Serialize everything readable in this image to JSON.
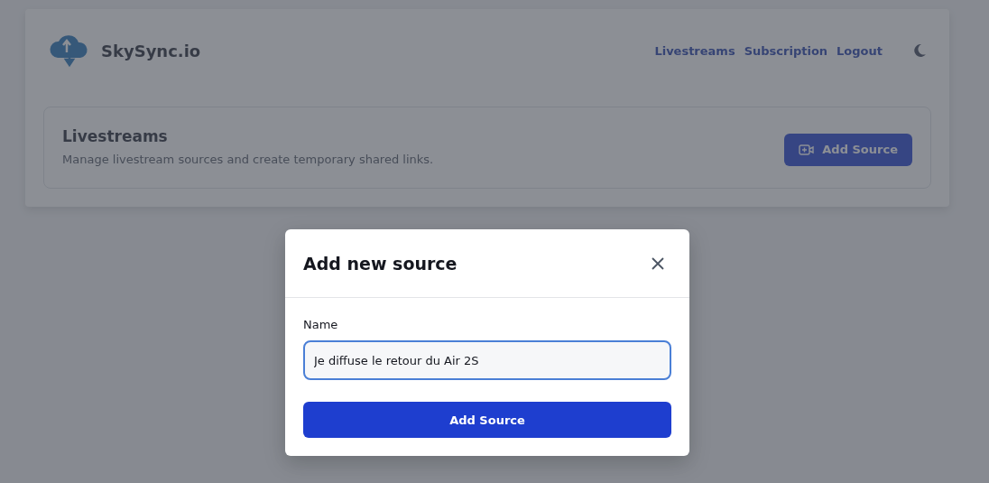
{
  "brand": {
    "name": "SkySync.io"
  },
  "nav": {
    "links": [
      {
        "label": "Livestreams"
      },
      {
        "label": "Subscription"
      },
      {
        "label": "Logout"
      }
    ],
    "dark_mode": false
  },
  "section": {
    "title": "Livestreams",
    "description": "Manage livestream sources and create temporary shared links.",
    "button": "Add Source"
  },
  "dialog": {
    "title": "Add new source",
    "field_label": "Name",
    "field_value": "Je diffuse le retour du Air 2S",
    "submit": "Add Source"
  }
}
